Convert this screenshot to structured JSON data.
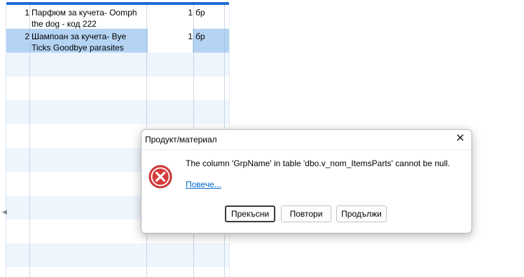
{
  "grid": {
    "rows": [
      {
        "num": "1",
        "name": "Парфюм за кучета- Oomph the dog - код 222",
        "qty": "1",
        "unit": "бр"
      },
      {
        "num": "2",
        "name": "Шампоан за кучета- Bye Ticks Goodbye parasites",
        "qty": "1",
        "unit": "бр"
      }
    ]
  },
  "dialog": {
    "title": "Продукт/материал",
    "close_symbol": "✕",
    "message": "The column 'GrpName' in table 'dbo.v_nom_ItemsParts' cannot be null.",
    "details_link": "Повече...",
    "buttons": {
      "abort": "Прекъсни",
      "retry": "Повтори",
      "continue": "Продължи"
    },
    "icon": "error-icon",
    "colors": {
      "error_red": "#d83b3b",
      "link": "#0066cc",
      "grid_accent": "#1b6fd6",
      "selection": "#b5d4f4"
    }
  }
}
